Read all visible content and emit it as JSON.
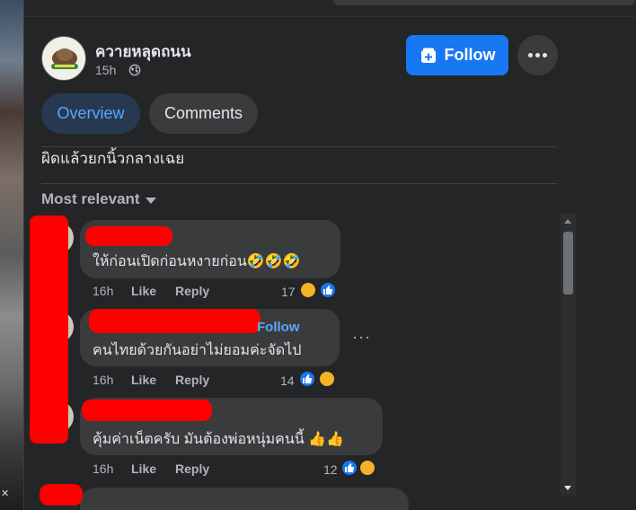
{
  "post": {
    "author": "ควายหลุดถนน",
    "time": "15h",
    "follow_label": "Follow",
    "caption": "ผิดแล้วยกนิ้วกลางเฉย"
  },
  "tabs": [
    {
      "label": "Overview",
      "active": true
    },
    {
      "label": "Comments",
      "active": false
    }
  ],
  "sort": {
    "label": "Most relevant"
  },
  "comments": [
    {
      "text": "ให้ก่อนเปิดก่อนหงายก่อน🤣🤣🤣",
      "time": "16h",
      "like": "Like",
      "reply": "Reply",
      "reactions": "17"
    },
    {
      "text": "คนไทยด้วยกันอย่าไม่ยอมค่ะจัดไป",
      "follow": "Follow",
      "time": "16h",
      "like": "Like",
      "reply": "Reply",
      "reactions": "14"
    },
    {
      "text": "คุ้มค่าเน็ตครับ มันต้องพ่อหนุ่มคนนี้ 👍👍",
      "time": "16h",
      "like": "Like",
      "reply": "Reply",
      "reactions": "12"
    }
  ],
  "colors": {
    "accent": "#1877f2",
    "redaction": "#ff0000",
    "background": "#242526"
  },
  "icons": [
    "globe-icon",
    "follow-page-icon",
    "more-dots-icon",
    "caret-down-icon",
    "like-reaction-icon",
    "haha-reaction-icon"
  ]
}
